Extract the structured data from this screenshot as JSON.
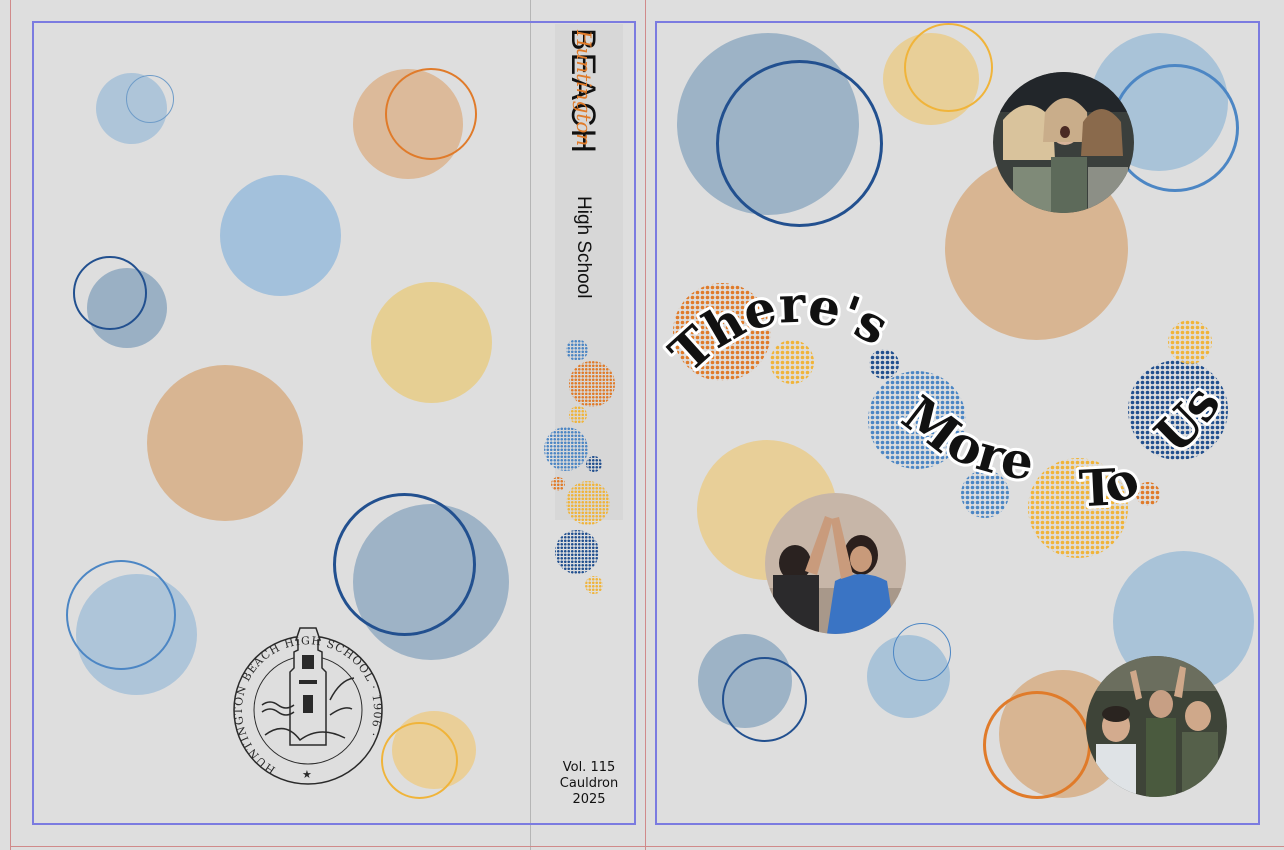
{
  "colors": {
    "background": "#dedede",
    "light_blue": "#a9c3d8",
    "slate_blue": "#95aec4",
    "mid_blue": "#9fbcd6",
    "navy": "#22508f",
    "ring_blue": "#4c86c4",
    "tan": "#d8b592",
    "orange": "#e07b2a",
    "yellow": "#e8cd8e",
    "gold": "#f0b43a",
    "guide_blue": "#7b7be0",
    "trim_red": "#d08a8a"
  },
  "spine": {
    "script": "Huntington",
    "word_beach": "BEACH",
    "word_high_school": "High School",
    "volume": "Vol. 115",
    "publication": "Cauldron",
    "year": "2025"
  },
  "seal": {
    "text": "HUNTINGTON BEACH HIGH SCHOOL · 1906 ·"
  },
  "title": {
    "line1": "There's",
    "line2": "More",
    "line3": "To",
    "line4": "Us"
  },
  "photos": [
    {
      "name": "photo-students-surprised",
      "icon": "crowd-photo"
    },
    {
      "name": "photo-high-five",
      "icon": "high-five-photo"
    },
    {
      "name": "photo-cheering-crowd",
      "icon": "crowd-photo"
    }
  ]
}
